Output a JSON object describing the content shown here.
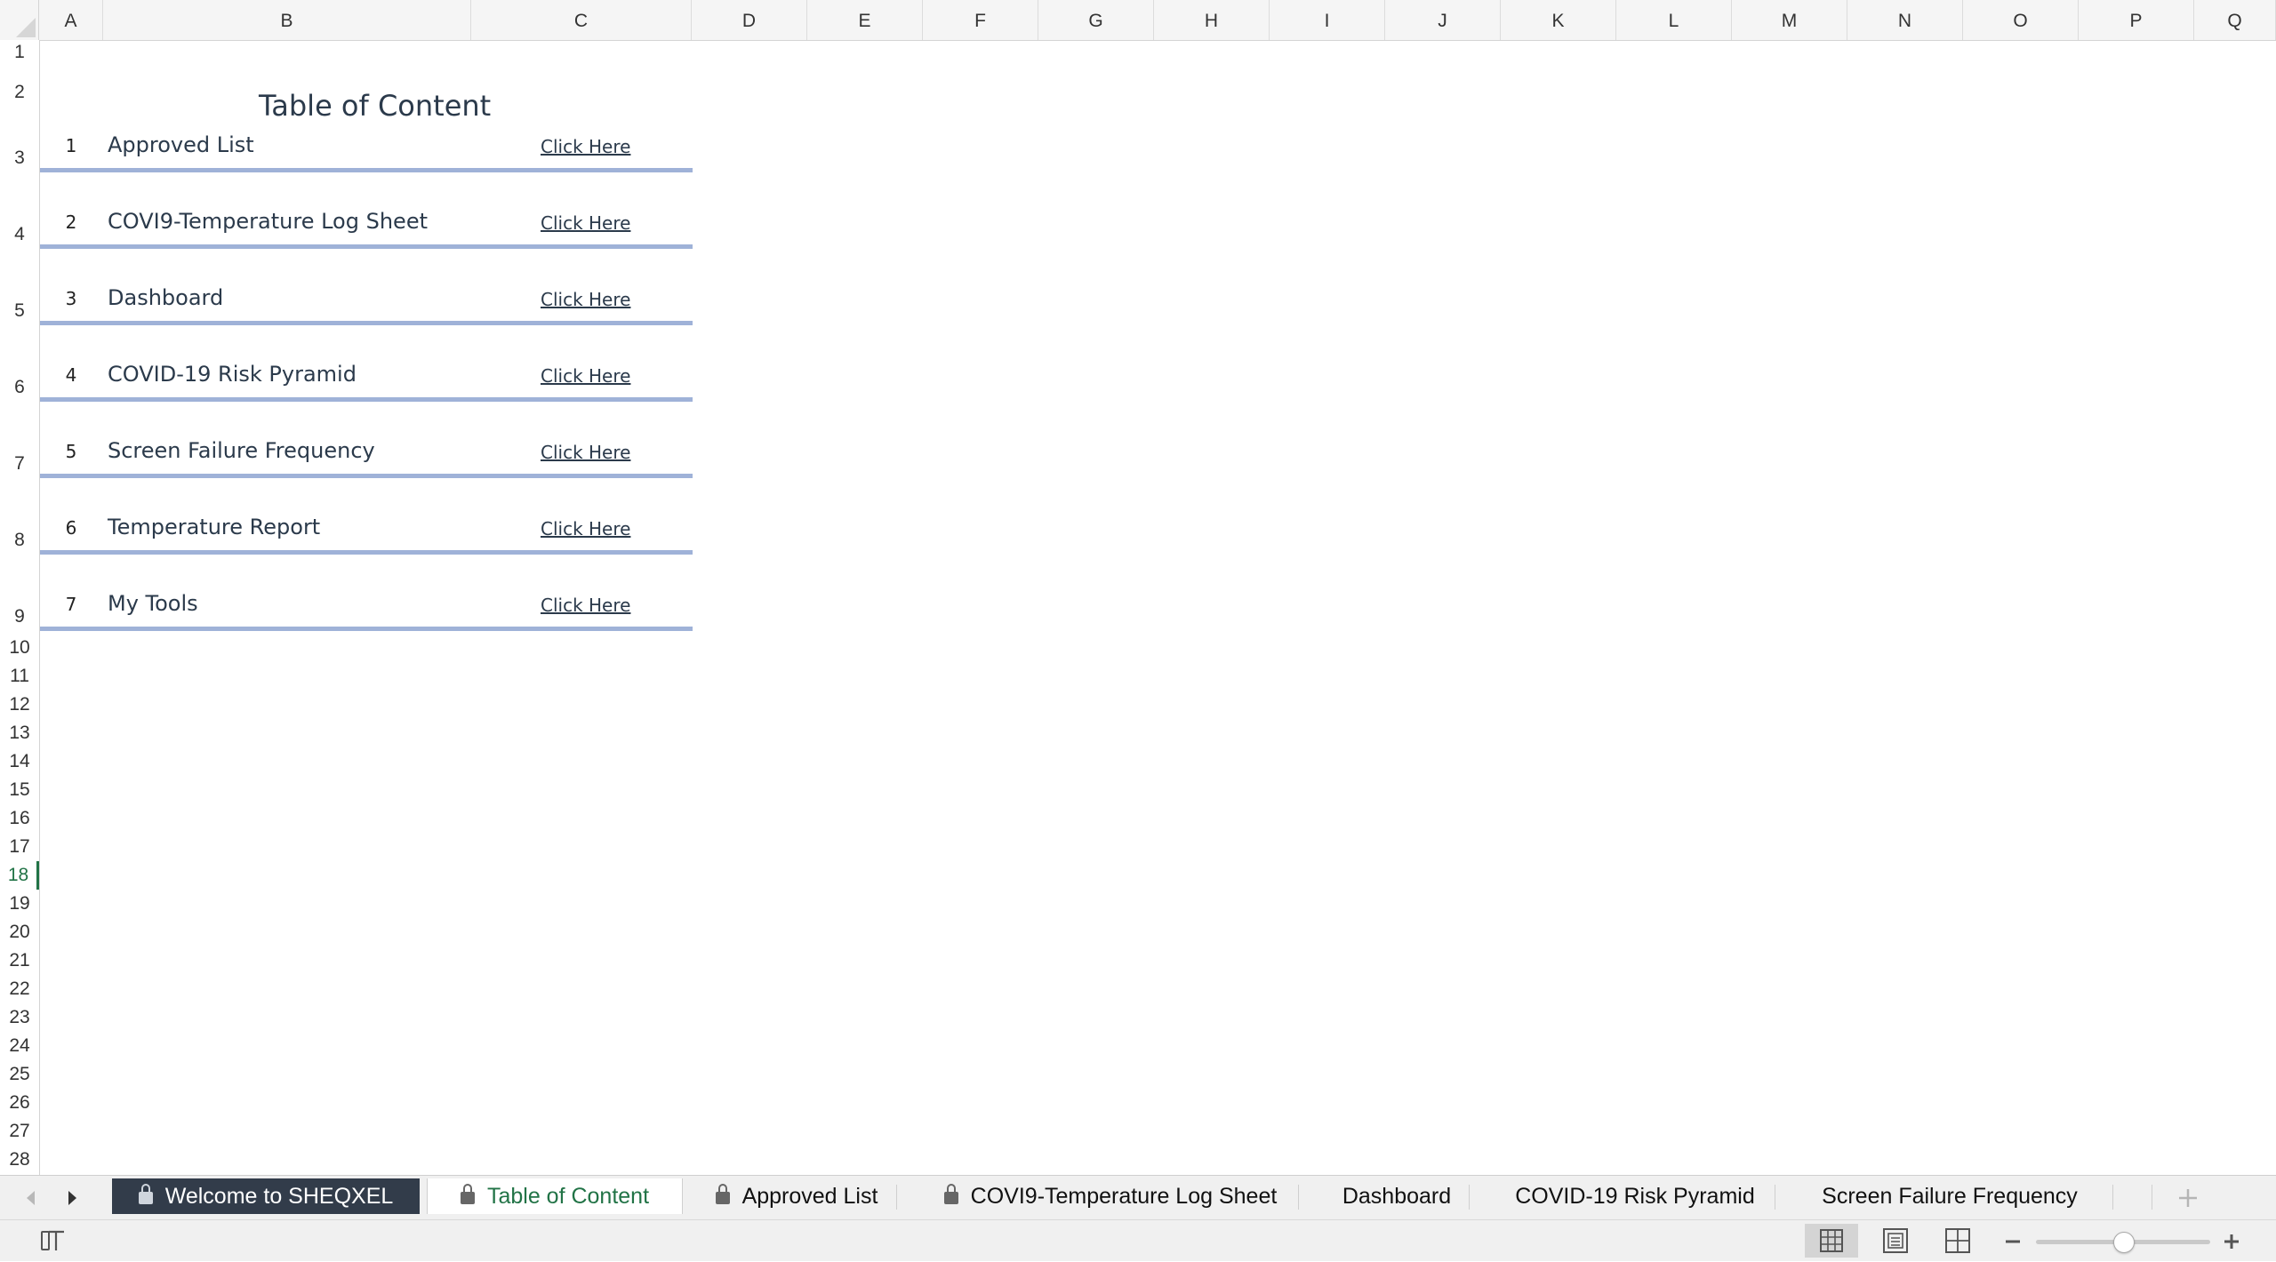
{
  "columns": [
    "A",
    "B",
    "C",
    "D",
    "E",
    "F",
    "G",
    "H",
    "I",
    "J",
    "K",
    "L",
    "M",
    "N",
    "O",
    "P",
    "Q"
  ],
  "rows": [
    "1",
    "2",
    "3",
    "4",
    "5",
    "6",
    "7",
    "8",
    "9",
    "10",
    "11",
    "12",
    "13",
    "14",
    "15",
    "16",
    "17",
    "18",
    "19",
    "20",
    "21",
    "22",
    "23",
    "24",
    "25",
    "26",
    "27",
    "28"
  ],
  "active_row": "18",
  "sheet": {
    "title": "Table of Content",
    "link_label": "Click Here",
    "items": [
      {
        "num": "1",
        "name": "Approved List"
      },
      {
        "num": "2",
        "name": "COVI9-Temperature Log Sheet"
      },
      {
        "num": "3",
        "name": "Dashboard"
      },
      {
        "num": "4",
        "name": "COVID-19 Risk Pyramid"
      },
      {
        "num": "5",
        "name": "Screen Failure Frequency"
      },
      {
        "num": "6",
        "name": "Temperature Report"
      },
      {
        "num": "7",
        "name": "My Tools"
      }
    ]
  },
  "tabs": [
    {
      "label": "Welcome to SHEQXEL",
      "locked": true,
      "style": "dark"
    },
    {
      "label": "Table of Content",
      "locked": true,
      "style": "active"
    },
    {
      "label": "Approved List",
      "locked": true,
      "style": "normal"
    },
    {
      "label": "COVI9-Temperature Log Sheet",
      "locked": true,
      "style": "normal"
    },
    {
      "label": "Dashboard",
      "locked": false,
      "style": "normal"
    },
    {
      "label": "COVID-19 Risk Pyramid",
      "locked": false,
      "style": "normal"
    },
    {
      "label": "Screen Failure Frequency",
      "locked": false,
      "style": "normal"
    }
  ],
  "icons": {
    "prev_sheet": "chevron-left-icon",
    "next_sheet": "chevron-right-icon",
    "add_sheet": "plus-icon",
    "normal_view": "grid-view-icon",
    "page_layout_view": "page-layout-icon",
    "page_break_view": "page-break-icon",
    "zoom_out": "minus-icon",
    "zoom_in": "plus-icon"
  },
  "colors": {
    "accent_green": "#217346",
    "toc_line": "#9fb2d8",
    "dark_tab": "#323c4a"
  },
  "zoom_level": 0.5
}
